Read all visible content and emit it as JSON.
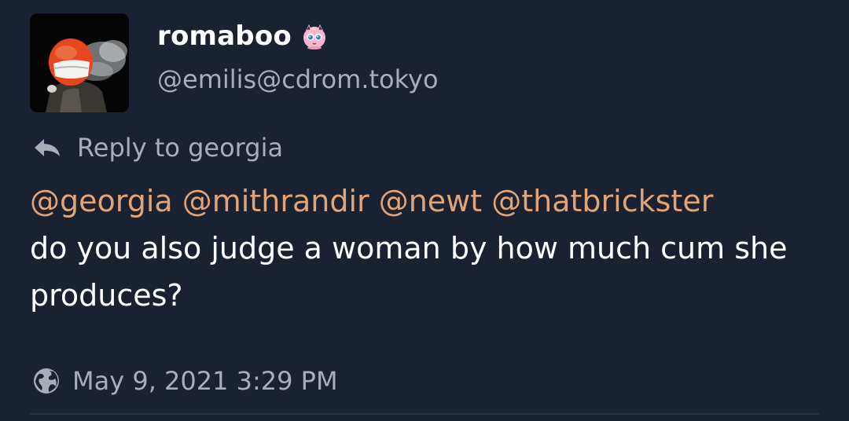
{
  "author": {
    "display_name": "romaboo",
    "handle": "@emilis@cdrom.tokyo",
    "avatar_icon": "avatar-helmet-person",
    "name_emoji_icon": "jigglypuff-emoji"
  },
  "reply": {
    "label": "Reply to georgia",
    "icon": "reply-arrow-icon"
  },
  "content": {
    "mentions": [
      "@georgia",
      "@mithrandir",
      "@newt",
      "@thatbrickster"
    ],
    "text": "do you also judge a woman by how much cum she produces?"
  },
  "meta": {
    "timestamp": "May 9, 2021 3:29 PM",
    "visibility_icon": "globe-icon"
  },
  "colors": {
    "background": "#1a2130",
    "mention": "#e0a477",
    "muted": "#a9adb8",
    "text": "#ffffff"
  }
}
